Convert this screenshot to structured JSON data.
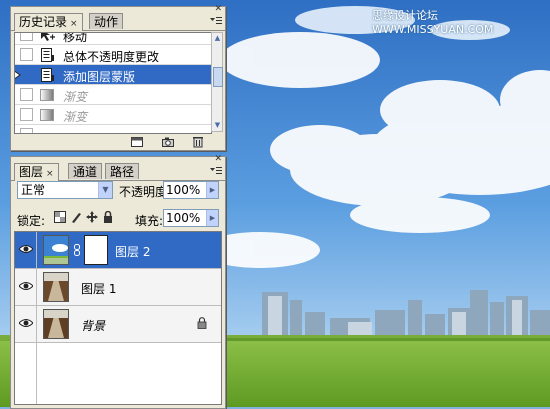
{
  "watermark": "思缘设计论坛 WWW.MISSYUAN.COM",
  "history_panel": {
    "tabs": [
      {
        "label": "历史记录",
        "active": true,
        "closable": true
      },
      {
        "label": "动作",
        "active": false
      }
    ],
    "items": [
      {
        "label": "移动",
        "icon": "move-step-icon",
        "state": "normal",
        "partial": true
      },
      {
        "label": "总体不透明度更改",
        "icon": "document-step-icon",
        "state": "normal"
      },
      {
        "label": "添加图层蒙版",
        "icon": "document-step-icon",
        "state": "selected"
      },
      {
        "label": "渐变",
        "icon": "gradient-step-icon",
        "state": "dimmed"
      },
      {
        "label": "渐变",
        "icon": "gradient-step-icon",
        "state": "dimmed"
      }
    ],
    "footer_icons": [
      "new-document-from-state-icon",
      "new-snapshot-icon",
      "trash-icon"
    ]
  },
  "layers_panel": {
    "tabs": [
      {
        "label": "图层",
        "active": true,
        "closable": true
      },
      {
        "label": "通道",
        "active": false
      },
      {
        "label": "路径",
        "active": false
      }
    ],
    "blend_mode": "正常",
    "opacity_label": "不透明度:",
    "opacity_value": "100%",
    "lock_label": "锁定:",
    "fill_label": "填充:",
    "fill_value": "100%",
    "layers": [
      {
        "name": "图层 2",
        "visible": true,
        "selected": true,
        "has_mask": true
      },
      {
        "name": "图层 1",
        "visible": true,
        "selected": false,
        "has_mask": false
      },
      {
        "name": "背景",
        "visible": true,
        "selected": false,
        "has_mask": false,
        "locked": true,
        "italic": true
      }
    ]
  },
  "colors": {
    "selection": "#316ac5",
    "panel_bg": "#ece9d8",
    "sky": "#4a8fd6",
    "grass": "#7ab83a"
  }
}
